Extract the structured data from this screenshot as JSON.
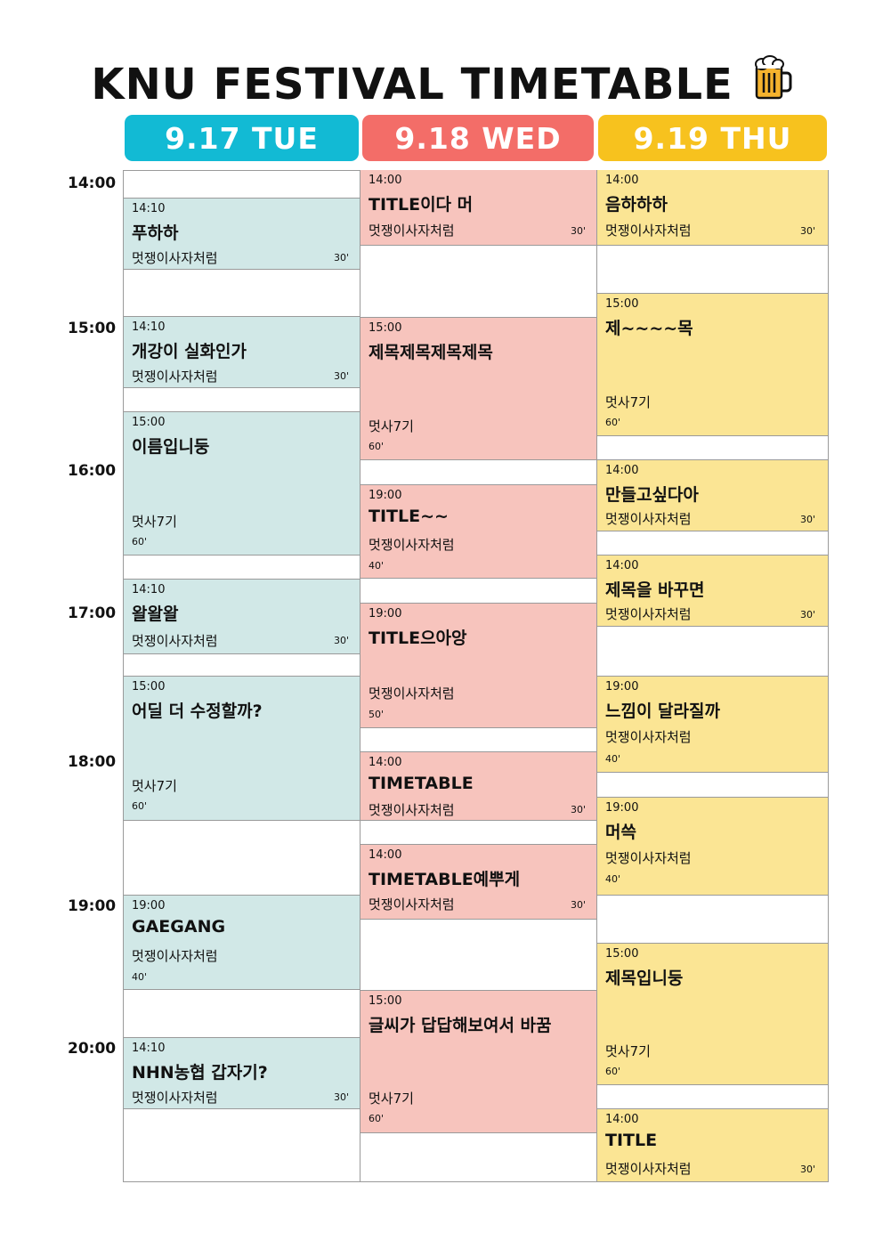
{
  "title": "KNU FESTIVAL TIMETABLE",
  "colors": {
    "tue_header": "#12bad4",
    "wed_header": "#f36d68",
    "thu_header": "#f7c21e",
    "tue_slot": "#d1e8e7",
    "wed_slot": "#f7c4bd",
    "thu_slot": "#fbe594"
  },
  "icons": {
    "title_icon": "beer-mug-icon"
  },
  "days": [
    {
      "label": "9.17 TUE"
    },
    {
      "label": "9.18 WED"
    },
    {
      "label": "9.19 THU"
    }
  ],
  "times": [
    "14:00",
    "15:00",
    "16:00",
    "17:00",
    "18:00",
    "19:00",
    "20:00"
  ],
  "slots": {
    "tue": [
      {
        "time": "14:10",
        "title": "푸하하",
        "performer": "멋쟁이사자처럼",
        "duration": "30'"
      },
      {
        "time": "14:10",
        "title": "개강이 실화인가",
        "performer": "멋쟁이사자처럼",
        "duration": "30'"
      },
      {
        "time": "15:00",
        "title": "이름입니둥",
        "performer": "멋사7기",
        "duration": "60'"
      },
      {
        "time": "14:10",
        "title": "왈왈왈",
        "performer": "멋쟁이사자처럼",
        "duration": "30'"
      },
      {
        "time": "15:00",
        "title": "어딜 더 수정할까?",
        "performer": "멋사7기",
        "duration": "60'"
      },
      {
        "time": "19:00",
        "title": "GAEGANG",
        "performer": "멋쟁이사자처럼",
        "duration": "40'"
      },
      {
        "time": "14:10",
        "title": "NHN농협 갑자기?",
        "performer": "멋쟁이사자처럼",
        "duration": "30'"
      }
    ],
    "wed": [
      {
        "time": "14:00",
        "title": "TITLE이다 머",
        "performer": "멋쟁이사자처럼",
        "duration": "30'"
      },
      {
        "time": "15:00",
        "title": "제목제목제목제목",
        "performer": "멋사7기",
        "duration": "60'"
      },
      {
        "time": "19:00",
        "title": "TITLE~~",
        "performer": "멋쟁이사자처럼",
        "duration": "40'"
      },
      {
        "time": "19:00",
        "title": "TITLE으아앙",
        "performer": "멋쟁이사자처럼",
        "duration": "50'"
      },
      {
        "time": "14:00",
        "title": "TIMETABLE",
        "performer": "멋쟁이사자처럼",
        "duration": "30'"
      },
      {
        "time": "14:00",
        "title": "TIMETABLE예뿌게",
        "performer": "멋쟁이사자처럼",
        "duration": "30'"
      },
      {
        "time": "15:00",
        "title": "글씨가 답답해보여서 바꿈",
        "performer": "멋사7기",
        "duration": "60'"
      }
    ],
    "thu": [
      {
        "time": "14:00",
        "title": "음하하하",
        "performer": "멋쟁이사자처럼",
        "duration": "30'"
      },
      {
        "time": "15:00",
        "title": "제~~~~목",
        "performer": "멋사7기",
        "duration": "60'"
      },
      {
        "time": "14:00",
        "title": "만들고싶다아",
        "performer": "멋쟁이사자처럼",
        "duration": "30'"
      },
      {
        "time": "14:00",
        "title": "제목을 바꾸면",
        "performer": "멋쟁이사자처럼",
        "duration": "30'"
      },
      {
        "time": "19:00",
        "title": "느낌이 달라질까",
        "performer": "멋쟁이사자처럼",
        "duration": "40'"
      },
      {
        "time": "19:00",
        "title": "머쓱",
        "performer": "멋쟁이사자처럼",
        "duration": "40'"
      },
      {
        "time": "15:00",
        "title": "제목입니둥",
        "performer": "멋사7기",
        "duration": "60'"
      },
      {
        "time": "14:00",
        "title": "TITLE",
        "performer": "멋쟁이사자처럼",
        "duration": "30'"
      }
    ]
  }
}
